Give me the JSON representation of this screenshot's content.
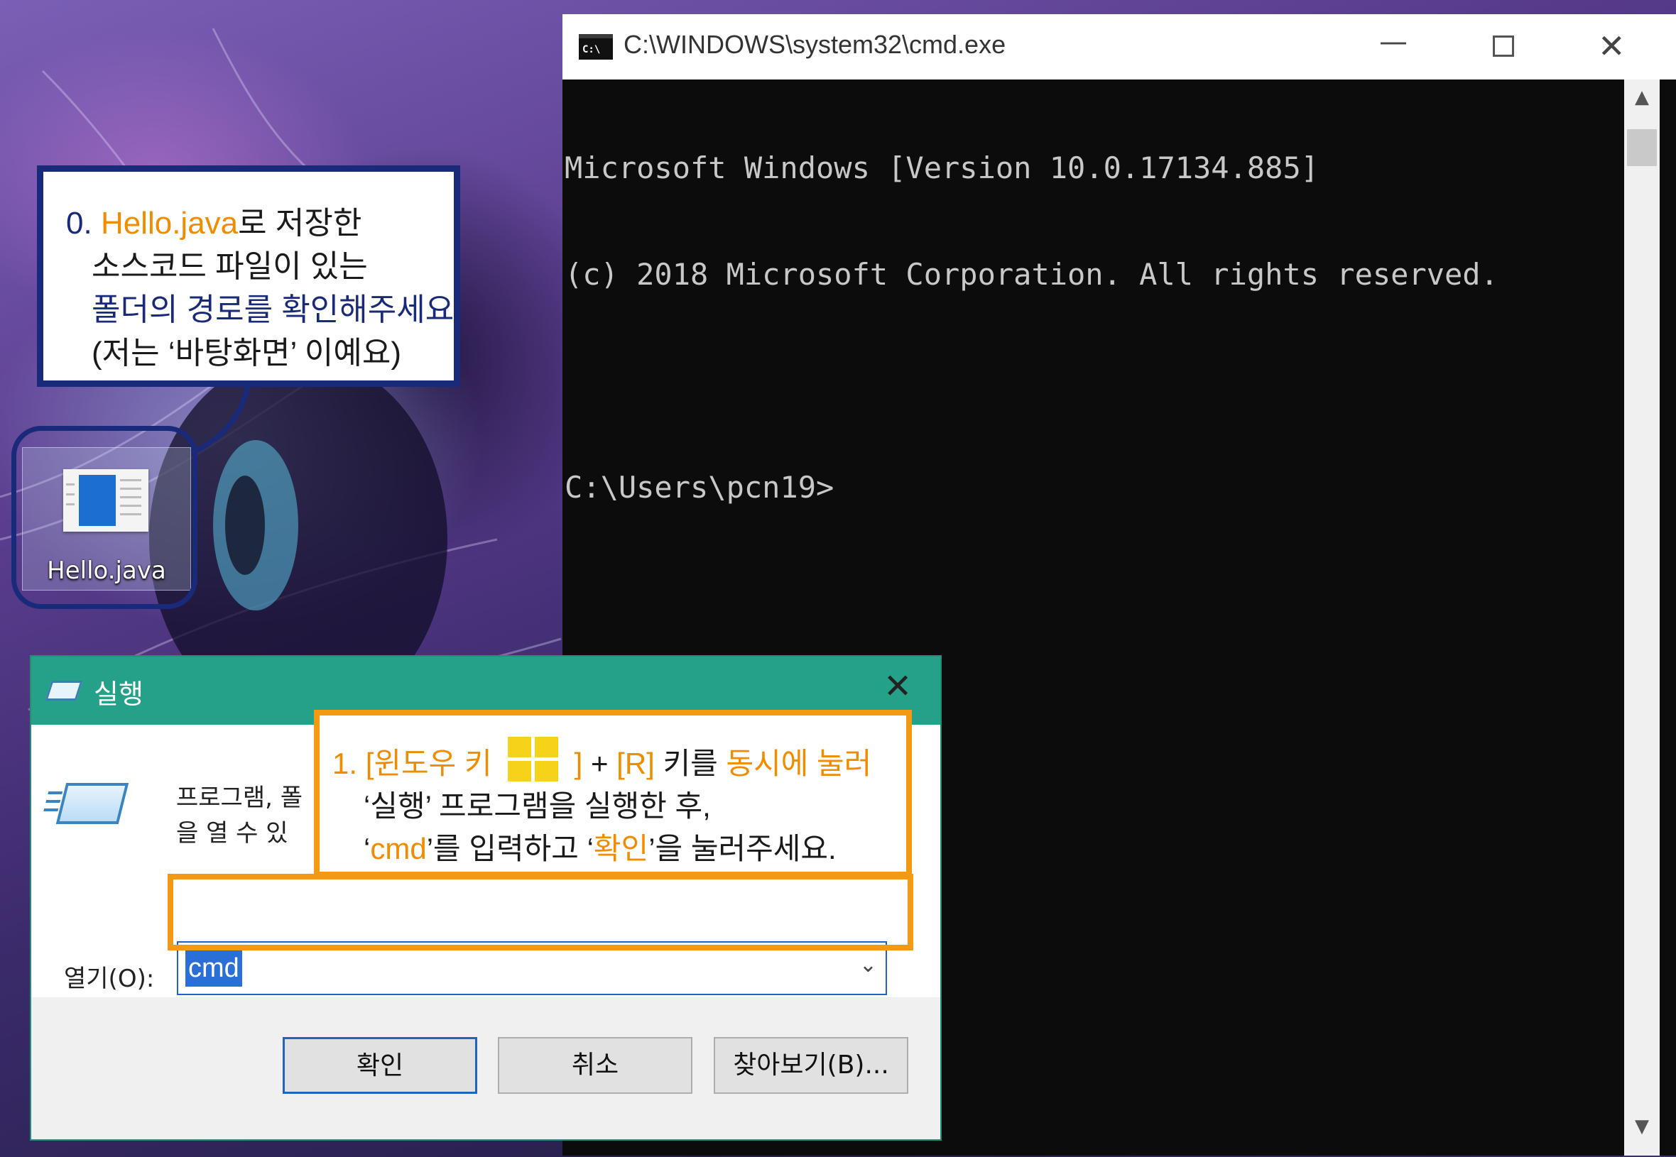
{
  "desktop": {
    "icon_label": "Hello.java"
  },
  "callout0": {
    "num": "0.",
    "file": "Hello.java",
    "line1_rest": "로 저장한",
    "line2": "소스코드 파일이 있는",
    "line3": "폴더의 경로를 확인해주세요",
    "line4": "(저는 ‘바탕화면’ 이예요)"
  },
  "cmd": {
    "title": "C:\\WINDOWS\\system32\\cmd.exe",
    "minimize": "—",
    "close": "✕",
    "console_lines": [
      "Microsoft Windows [Version 10.0.17134.885]",
      "(c) 2018 Microsoft Corporation. All rights reserved.",
      "",
      "C:\\Users\\pcn19>"
    ]
  },
  "run_dialog": {
    "title": "실행",
    "close": "✕",
    "description_line1": "프로그램, 폴",
    "description_line2": "을 열 수 있",
    "open_label": "열기(O):",
    "open_value": "cmd",
    "ok_label": "확인",
    "cancel_label": "취소",
    "browse_label": "찾아보기(B)..."
  },
  "callout1": {
    "num": "1.",
    "bracket_open": "[윈도우 키",
    "bracket_close": "]",
    "plus": "+",
    "r_key": "[R]",
    "key_word": "키를",
    "press": "동시에 눌러",
    "line2": "‘실행’ 프로그램을 실행한 후,",
    "q_open": "‘",
    "cmd": "cmd",
    "line3_mid": "’를 입력하고 ‘",
    "ok": "확인",
    "line3_end": "’을 눌러주세요."
  },
  "colors": {
    "callout_navy": "#1a2a7a",
    "callout_orange": "#f49a12",
    "run_titlebar": "#25a18a",
    "selection_blue": "#2a6ed8"
  }
}
